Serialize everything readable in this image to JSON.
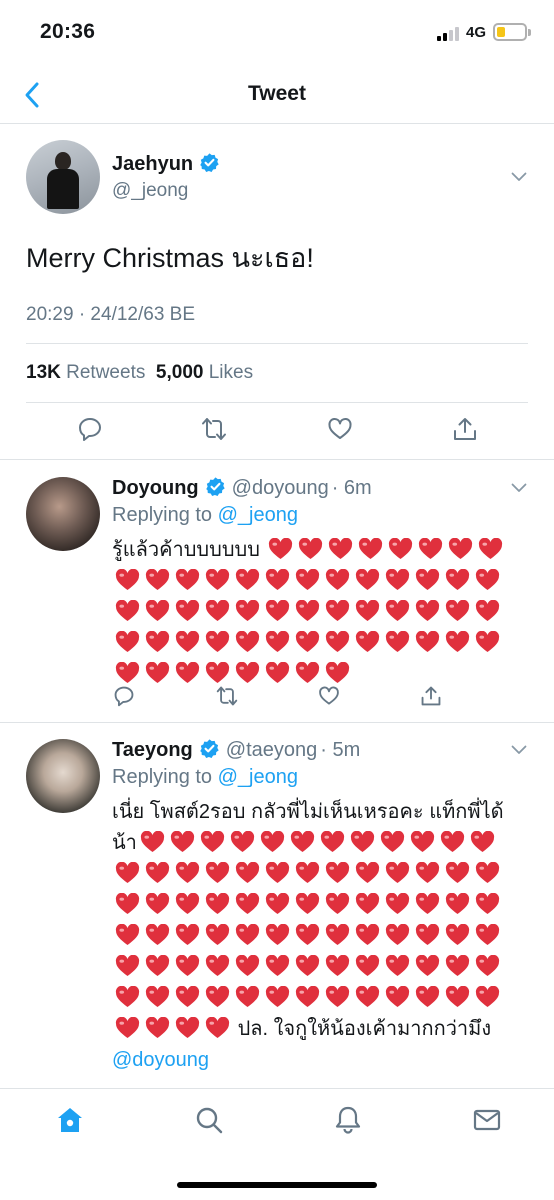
{
  "status_bar": {
    "time": "20:36",
    "network": "4G",
    "battery_level": 0.3,
    "battery_color": "#f5c518"
  },
  "nav": {
    "title": "Tweet",
    "back_icon": "chevron-left-icon"
  },
  "colors": {
    "accent": "#1da1f2",
    "secondary_text": "#657786",
    "heart": "#e0303d"
  },
  "main_tweet": {
    "name": "Jaehyun",
    "handle": "@_jeong",
    "text": "Merry Christmas นะเธอ!",
    "timestamp": "20:29 · 24/12/63 BE",
    "retweets_count": "13K",
    "retweets_label": "Retweets",
    "likes_count": "5,000",
    "likes_label": "Likes",
    "actions": [
      "reply-icon",
      "retweet-icon",
      "like-icon",
      "share-icon"
    ]
  },
  "replies": [
    {
      "name": "Doyoung",
      "handle": "@doyoung",
      "time": "· 6m",
      "replying_prefix": "Replying to",
      "replying_to": "@_jeong",
      "text": "รู้แล้วค้าบบบบบบ",
      "heart_count": 55
    },
    {
      "name": "Taeyong",
      "handle": "@taeyong",
      "time": "· 5m",
      "replying_prefix": "Replying to",
      "replying_to": "@_jeong",
      "text_before": "เนี่ย โพสต์2รอบ กลัวพี่ไม่เห็นเหรอคะ แท็กพี่ได้น้า",
      "heart_count": 81,
      "text_after": "ปล. ใจกูให้น้องเค้ามากกว่ามึง",
      "mention": "@doyoung"
    }
  ],
  "tab_bar": [
    "home-icon",
    "search-icon",
    "notifications-icon",
    "messages-icon"
  ]
}
